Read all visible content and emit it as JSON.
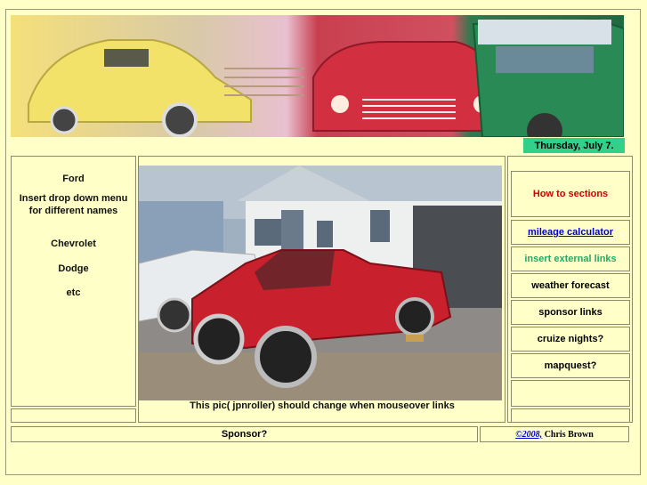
{
  "header": {
    "banner_alt": "",
    "date": "Thursday, July 7."
  },
  "left_menu": {
    "items": [
      {
        "label": "Ford"
      },
      {
        "label": "Insert drop down menu"
      },
      {
        "label": "for different names"
      },
      {
        "label": "Chevrolet"
      },
      {
        "label": "Dodge"
      },
      {
        "label": "etc"
      }
    ]
  },
  "main": {
    "caption": "This pic( jpnroller) should change when mouseover links"
  },
  "right_menu": {
    "items": [
      {
        "label": "How to sections",
        "color": "#CC0000",
        "link": false
      },
      {
        "label": "mileage calculator",
        "color": "#0000CC",
        "link": true
      },
      {
        "label": "insert external links",
        "color": "#22AA66",
        "link": false
      },
      {
        "label": "weather forecast",
        "color": "#111111",
        "link": false
      },
      {
        "label": "sponsor links",
        "color": "#111111",
        "link": false
      },
      {
        "label": "cruize nights?",
        "color": "#111111",
        "link": false
      },
      {
        "label": "mapquest?",
        "color": "#111111",
        "link": false
      },
      {
        "label": "",
        "color": "#111111",
        "link": false
      }
    ]
  },
  "footer": {
    "sponsor": "Sponsor?",
    "copyright_link": "©2008,",
    "author": " Chris Brown"
  },
  "colors": {
    "page_bg": "#FFFFC8",
    "date_bar": "#33D08A"
  }
}
